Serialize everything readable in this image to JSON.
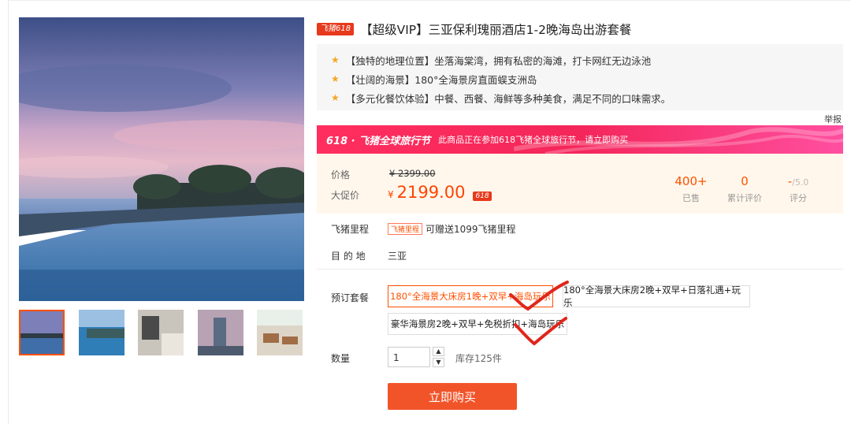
{
  "product": {
    "badge": "飞猪618",
    "title": "【超级VIP】三亚保利瑰丽酒店1-2晚海岛出游套餐",
    "highlights": [
      "【独特的地理位置】坐落海棠湾，拥有私密的海滩，打卡网红无边泳池",
      "【壮阔的海景】180°全海景房直面蜈支洲岛",
      "【多元化餐饮体验】中餐、西餐、海鲜等多种美食，满足不同的口味需求。"
    ],
    "report_label": "举报"
  },
  "banner": {
    "logo": "618 · 飞猪全球旅行节",
    "text": "此商品正在参加618飞猪全球旅行节，请立即购买"
  },
  "price": {
    "price_label": "价格",
    "original": "¥ 2399.00",
    "promo_label": "大促价",
    "currency": "¥",
    "promo_value": "2199.00",
    "promo_tag": "618",
    "sold_value": "400+",
    "sold_label": "已售",
    "reviews_value": "0",
    "reviews_label": "累计评价",
    "rating_value": "-",
    "rating_max": "/5.0",
    "rating_label": "评分"
  },
  "miles": {
    "label": "飞猪里程",
    "tag": "飞猪里程",
    "text": "可赠送1099飞猪里程"
  },
  "destination": {
    "label": "目 的 地",
    "value": "三亚"
  },
  "package": {
    "label": "预订套餐",
    "options": [
      "180°全海景大床房1晚+双早+海岛玩乐",
      "180°全海景大床房2晚+双早+日落礼遇+玩乐",
      "豪华海景房2晚+双早+免税折扣+海岛玩乐"
    ]
  },
  "quantity": {
    "label": "数量",
    "value": "1",
    "stock": "库存125件"
  },
  "buy_label": "立即购买",
  "colors": {
    "accent": "#ff5000",
    "banner_pink": "#f4265a",
    "price_bg": "#fff7ec",
    "buy_button": "#f2542a"
  }
}
